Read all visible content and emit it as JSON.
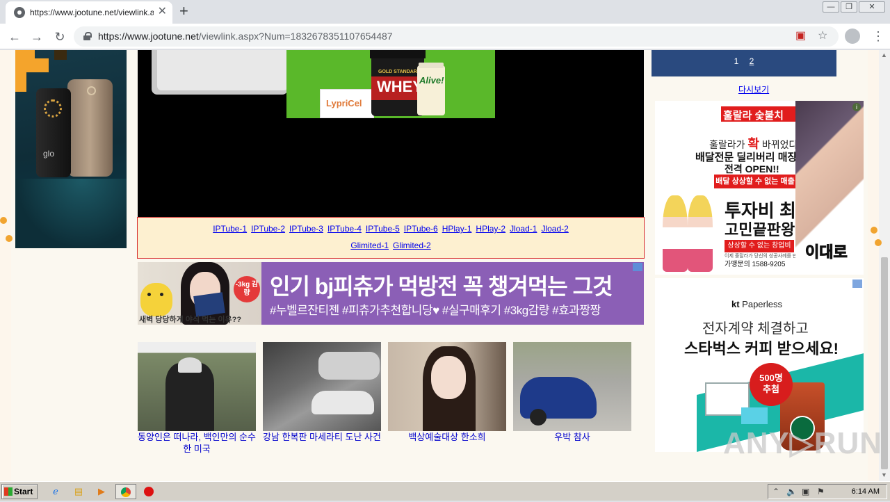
{
  "browser": {
    "tab_title": "https://www.jootune.net/viewlink.a",
    "new_tab": "+",
    "tab_close": "✕",
    "url_host": "https://www.jootune.net",
    "url_path": "/viewlink.aspx?Num=1832678351107654487",
    "window_minimize": "—",
    "window_restore": "❐",
    "window_close": "✕"
  },
  "video": {
    "supplement_ad": {
      "whey_label": "WHEY",
      "whey_sub": "GOLD STANDARD",
      "alive_label": "Alive!",
      "lypri_label": "LypriCel"
    }
  },
  "left_ad": {
    "brand": "glo"
  },
  "mirrors": {
    "row1": [
      "IPTube-1",
      "IPTube-2",
      "IPTube-3",
      "IPTube-4",
      "IPTube-5",
      "IPTube-6",
      "HPlay-1",
      "HPlay-2",
      "Jload-1",
      "Jload-2"
    ],
    "row2": [
      "Glimited-1",
      "Glimited-2"
    ]
  },
  "banner": {
    "title": "인기 bj피츄가 먹방전 꼭 챙겨먹는 그것",
    "tags": "#누벨르잔티젠 #피츄가추천합니당♥ #실구매후기 #3kg감량 #효과짱짱",
    "badge": "-3kg 감량",
    "sub": "새벽 당당하게 야식 먹는 이유??"
  },
  "thumbnails": [
    {
      "caption": "동양인은 떠나라, 백인만의 순수한 미국"
    },
    {
      "caption": "강남 한복판 마세라티 도난 사건"
    },
    {
      "caption": "백상예술대상 한소희"
    },
    {
      "caption": "우박 참사"
    }
  ],
  "pager": {
    "page1": "1",
    "page2": "2",
    "reload": "다시보기"
  },
  "ad_right1": {
    "logo": "훌랄라 숯불치",
    "line1_pre": "훌랄라가 ",
    "line1_hl": "확",
    "line1_post": " 바뀌었다!",
    "line2": "배달전문 딜리버리 매장",
    "line3": "전격 OPEN!!",
    "pill": "배달 상상할 수 없는 매출",
    "big1": "투자비 최",
    "big2": "고민끝판왕",
    "pill2": "상상할 수 없는 창업비",
    "fine": "이제 훌랄라가 당신의 성공사례를 만들어",
    "phone": "가맹문의 1588-9205",
    "side_text": "이대로",
    "info": "i"
  },
  "ad_right2": {
    "logo_kt": "kt",
    "logo_rest": " Paperless",
    "line1": "전자계약 체결하고",
    "line2": "스타벅스 커피 받으세요!",
    "badge_top": "500명",
    "badge_bottom": "추첨"
  },
  "watermark": "ANY▷RUN",
  "taskbar": {
    "start": "Start",
    "clock": "6:14 AM"
  }
}
